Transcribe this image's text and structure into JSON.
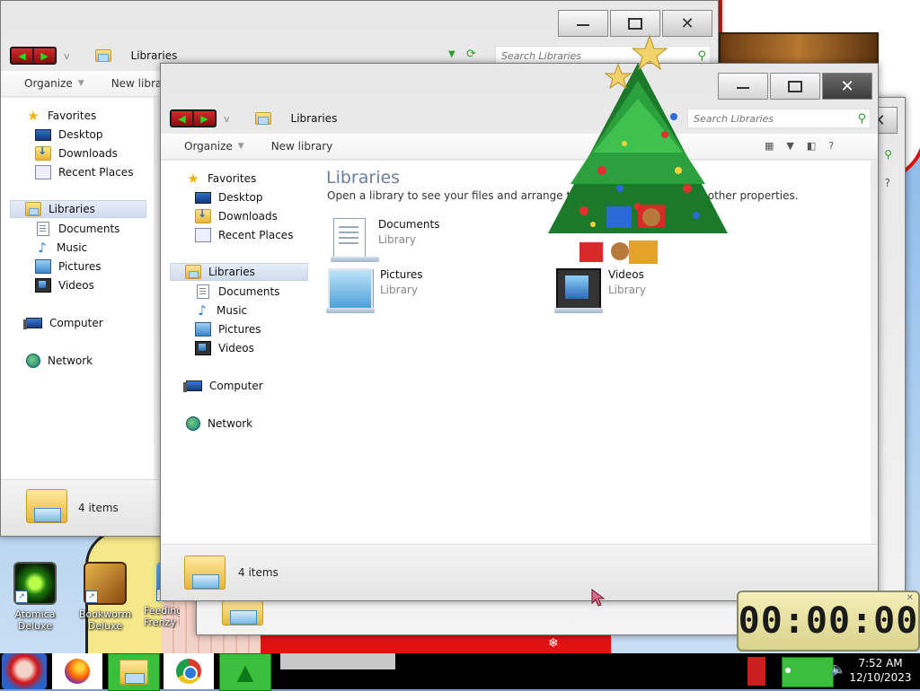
{
  "desktop": {
    "icons": [
      {
        "label_line1": "Atomica",
        "label_line2": "Deluxe",
        "icon": "atomica-icon"
      },
      {
        "label_line1": "Bookworm",
        "label_line2": "Deluxe",
        "icon": "bookworm-icon"
      },
      {
        "label_line1": "Feeding",
        "label_line2": "Frenzy Delu",
        "icon": "feeding-frenzy-icon"
      }
    ]
  },
  "back_window": {
    "breadcrumb": "Libraries",
    "search_placeholder": "Search Libraries",
    "commands": {
      "organize": "Organize",
      "new_library": "New library"
    },
    "nav": {
      "favorites": "Favorites",
      "desktop": "Desktop",
      "downloads": "Downloads",
      "recent_places": "Recent Places",
      "libraries": "Libraries",
      "documents": "Documents",
      "music": "Music",
      "pictures": "Pictures",
      "videos": "Videos",
      "computer": "Computer",
      "network": "Network"
    },
    "status": "4 items"
  },
  "front_window": {
    "breadcrumb": "Libraries",
    "search_placeholder": "Search Libraries",
    "commands": {
      "organize": "Organize",
      "new_library": "New library"
    },
    "nav": {
      "favorites": "Favorites",
      "desktop": "Desktop",
      "downloads": "Downloads",
      "recent_places": "Recent Places",
      "libraries": "Libraries",
      "documents": "Documents",
      "music": "Music",
      "pictures": "Pictures",
      "videos": "Videos",
      "computer": "Computer",
      "network": "Network"
    },
    "heading": "Libraries",
    "subheading": "Open a library to see your files and arrange them by folder, date, and other properties.",
    "libraries": [
      {
        "name": "Documents",
        "type": "Library"
      },
      {
        "name": "Pictures",
        "type": "Library"
      },
      {
        "name": "Videos",
        "type": "Library"
      }
    ],
    "status": "4 items"
  },
  "timer": {
    "display": "00:00:00"
  },
  "taskbar": {
    "clock_time": "7:52 AM",
    "clock_date": "12/10/2023"
  },
  "colors": {
    "accent_green": "#3cbf3c",
    "title_close_active": "#3d3d3d",
    "heading": "#6b7f98"
  }
}
